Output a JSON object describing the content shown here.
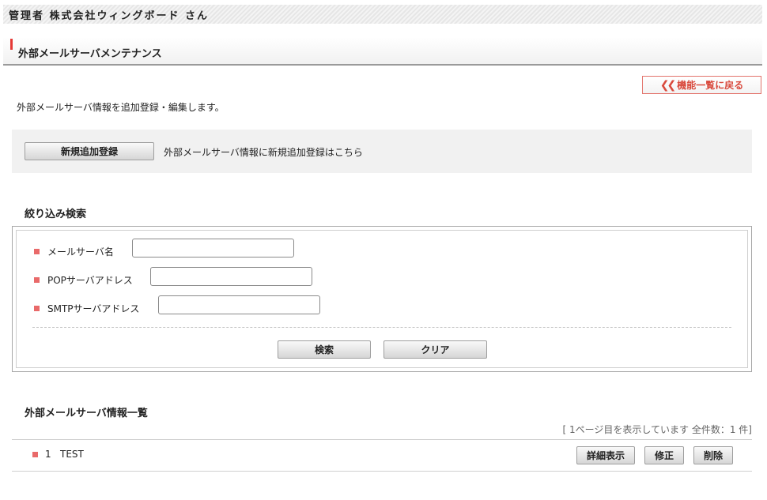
{
  "header": {
    "admin_title": "管理者 株式会社ウィングボード さん"
  },
  "page": {
    "title": "外部メールサーバメンテナンス",
    "description": "外部メールサーバ情報を追加登録・編集します。"
  },
  "back_button": {
    "label": "機能一覧に戻る"
  },
  "new_registration": {
    "button_label": "新規追加登録",
    "hint": "外部メールサーバ情報に新規追加登録はこちら"
  },
  "search": {
    "title": "絞り込み検索",
    "fields": [
      {
        "label": "メールサーバ名",
        "value": ""
      },
      {
        "label": "POPサーバアドレス",
        "value": ""
      },
      {
        "label": "SMTPサーバアドレス",
        "value": ""
      }
    ],
    "search_button": "検索",
    "clear_button": "クリア"
  },
  "list": {
    "title": "外部メールサーバ情報一覧",
    "count_text": "[ 1ページ目を表示しています 全件数：1 件]",
    "rows": [
      {
        "index": "1",
        "name": "TEST"
      }
    ],
    "actions": {
      "detail": "詳細表示",
      "edit": "修正",
      "delete": "削除"
    }
  },
  "colors": {
    "accent": "#e53935",
    "bullet": "#e96a6a",
    "back_button": "#d94a3d"
  },
  "icons": {
    "back": "double-chevron-left-icon",
    "bullet": "square-bullet-icon"
  }
}
